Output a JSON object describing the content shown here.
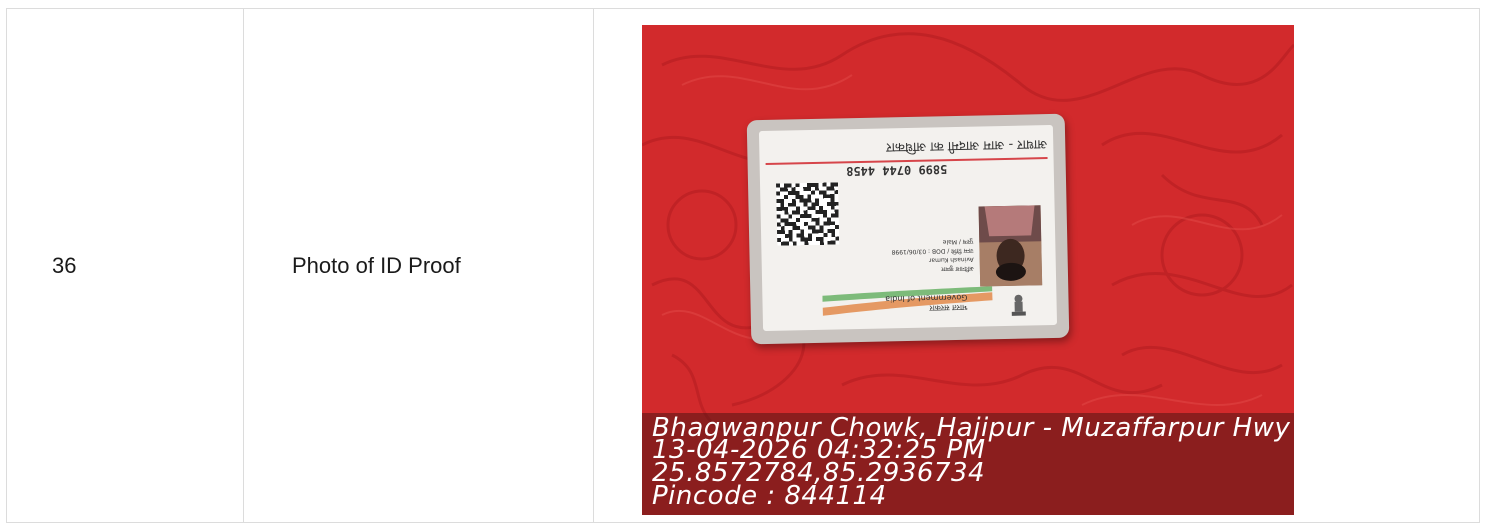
{
  "row": {
    "serial": "36",
    "label": "Photo of ID Proof"
  },
  "photo": {
    "card": {
      "header": "आधार - आम आदमी का अधिकार",
      "number": "5899 0744 4458",
      "details": [
        "अविनाश कुमार",
        "Avinash Kumar",
        "जन्म तिथि / DOB : 03/06/1998",
        "पुरुष / Male"
      ],
      "gov_hindi": "भारत सरकार",
      "gov_english": "Government of India"
    },
    "stamp": {
      "location": "Bhagwanpur Chowk, Hajipur - Muzaffarpur Hwy",
      "datetime": "13-04-2026 04:32:25 PM",
      "coords": "25.8572784,85.2936734",
      "pincode": "Pincode : 844114"
    }
  },
  "colors": {
    "background_red": "#d42a2a",
    "overlay": "#501414",
    "border": "#dcdcdc"
  }
}
